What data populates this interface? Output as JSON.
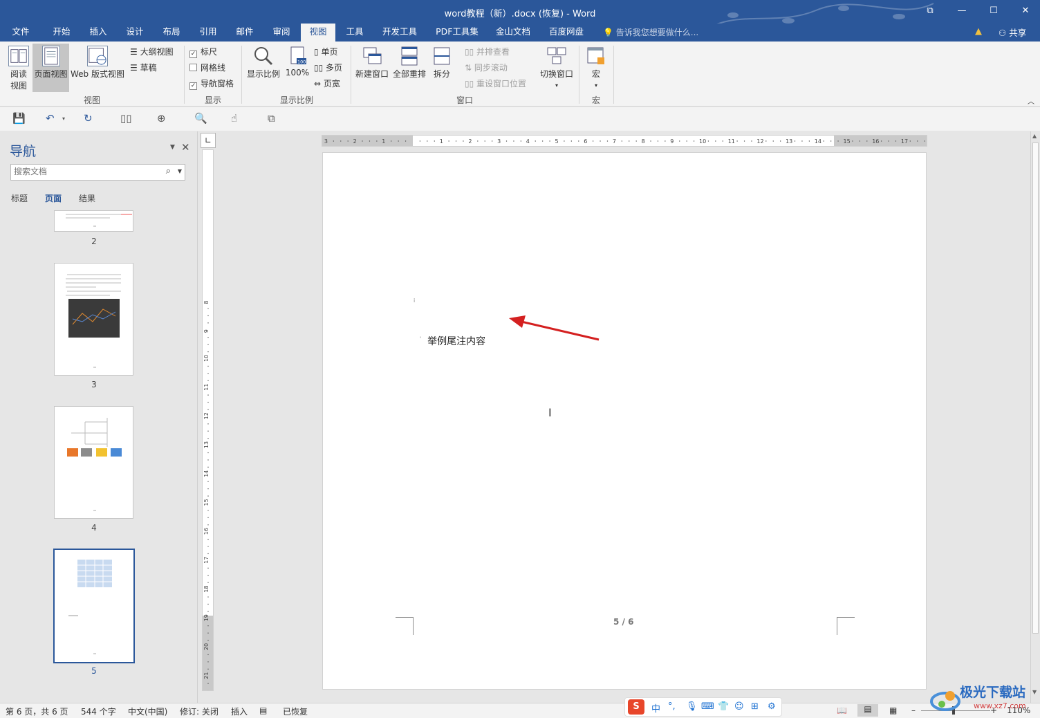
{
  "window": {
    "title": "word教程（新）.docx (恢复) - Word",
    "minimize": "—",
    "maximize": "☐",
    "close": "✕",
    "restore": "⧉"
  },
  "tabs": [
    {
      "label": "文件"
    },
    {
      "label": "开始"
    },
    {
      "label": "插入"
    },
    {
      "label": "设计"
    },
    {
      "label": "布局"
    },
    {
      "label": "引用"
    },
    {
      "label": "邮件"
    },
    {
      "label": "审阅"
    },
    {
      "label": "视图",
      "active": true
    },
    {
      "label": "工具"
    },
    {
      "label": "开发工具"
    },
    {
      "label": "PDF工具集"
    },
    {
      "label": "金山文档"
    },
    {
      "label": "百度网盘"
    }
  ],
  "tellme": "告诉我您想要做什么...",
  "share": "共享",
  "ribbon": {
    "views": {
      "read": "阅读\n视图",
      "read_1": "阅读",
      "read_2": "视图",
      "print": "页面视图",
      "web": "Web 版式视图",
      "outline": "大纲视图",
      "draft": "草稿",
      "group": "视图"
    },
    "show": {
      "ruler": "标尺",
      "gridlines": "网格线",
      "navpane": "导航窗格",
      "group": "显示",
      "ruler_checked": true,
      "gridlines_checked": false,
      "navpane_checked": true
    },
    "zoom": {
      "zoom": "显示比例",
      "hundred": "100%",
      "onepage": "单页",
      "multipage": "多页",
      "pagewidth": "页宽",
      "group": "显示比例",
      "badge": "100"
    },
    "window": {
      "newwin": "新建窗口",
      "arrange": "全部重排",
      "split": "拆分",
      "sidebyside": "并排查看",
      "syncscroll": "同步滚动",
      "resetpos": "重设窗口位置",
      "switch": "切换窗口",
      "group": "窗口"
    },
    "macro": {
      "macro": "宏",
      "group": "宏"
    }
  },
  "nav": {
    "title": "导航",
    "search_placeholder": "搜索文档",
    "tabs": [
      "标题",
      "页面",
      "结果"
    ],
    "active_tab": "页面",
    "pages": [
      "2",
      "3",
      "4",
      "5"
    ],
    "selected_page": "5"
  },
  "document": {
    "endnote_mark": "i",
    "endnote_text": "举例尾注内容",
    "page_footer": "5 / 6"
  },
  "status": {
    "page": "第 6 页，共 6 页",
    "words": "544 个字",
    "lang": "中文(中国)",
    "revisions": "修订: 关闭",
    "mode": "插入",
    "recovered": "已恢复",
    "zoom": "110%"
  },
  "ime": {
    "lang": "中",
    "punct": "°,"
  },
  "watermark": {
    "text": "极光下载站",
    "url": "www.xz7.com"
  },
  "colors": {
    "title_bar": "#2b579a",
    "ribbon_bg": "#f3f3f3",
    "canvas_bg": "#e6e6e6",
    "annotation_arrow": "#d42020"
  }
}
